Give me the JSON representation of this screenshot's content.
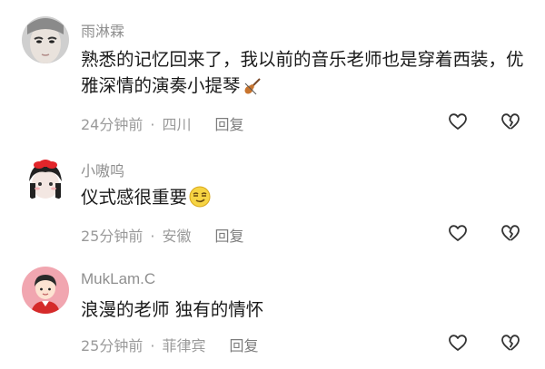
{
  "comments": [
    {
      "username": "雨淋霖",
      "text": "熟悉的记忆回来了，我以前的音乐老师也是穿着西装，优雅深情的演奏小提琴",
      "emoji": "violin-emoji",
      "time": "24分钟前",
      "location": "四川",
      "reply": "回复",
      "like_icon": "heart-outline-icon",
      "dislike_icon": "broken-heart-icon"
    },
    {
      "username": "小嗷呜",
      "text": "仪式感很重要",
      "emoji": "smug-face-emoji",
      "time": "25分钟前",
      "location": "安徽",
      "reply": "回复",
      "like_icon": "heart-outline-icon",
      "dislike_icon": "broken-heart-icon"
    },
    {
      "username": "MukLam.C",
      "text": "浪漫的老师 独有的情怀",
      "emoji": "",
      "time": "25分钟前",
      "location": "菲律宾",
      "reply": "回复",
      "like_icon": "heart-outline-icon",
      "dislike_icon": "broken-heart-icon"
    }
  ],
  "separator": "·",
  "colors": {
    "text": "#1a1a1a",
    "muted": "#9a9a9a",
    "background": "#ffffff"
  }
}
